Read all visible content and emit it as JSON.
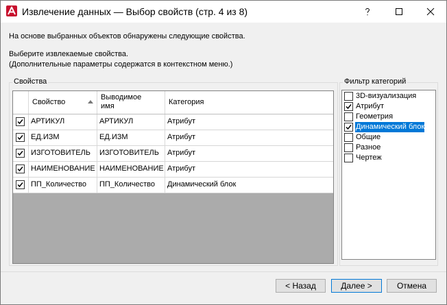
{
  "window": {
    "title": "Извлечение данных — Выбор свойств (стр. 4 из 8)"
  },
  "intro": {
    "line1": "На основе выбранных объектов обнаружены следующие свойства.",
    "line2": "Выберите извлекаемые свойства.",
    "line3": "(Дополнительные параметры содержатся в контекстном меню.)"
  },
  "properties": {
    "legend": "Свойства",
    "columns": {
      "property": "Свойство",
      "display_name_1": "Выводимое",
      "display_name_2": "имя",
      "category": "Категория"
    },
    "sort_column": "Свойство",
    "rows": [
      {
        "checked": true,
        "property": "АРТИКУЛ",
        "display_name": "АРТИКУЛ",
        "category": "Атрибут"
      },
      {
        "checked": true,
        "property": "ЕД.ИЗМ",
        "display_name": "ЕД.ИЗМ",
        "category": "Атрибут"
      },
      {
        "checked": true,
        "property": "ИЗГОТОВИТЕЛЬ",
        "display_name": "ИЗГОТОВИТЕЛЬ",
        "category": "Атрибут"
      },
      {
        "checked": true,
        "property": "НАИМЕНОВАНИЕ",
        "display_name": "НАИМЕНОВАНИЕ",
        "category": "Атрибут"
      },
      {
        "checked": true,
        "property": "ПП_Количество",
        "display_name": "ПП_Количество",
        "category": "Динамический блок"
      }
    ]
  },
  "filter": {
    "legend": "Фильтр категорий",
    "items": [
      {
        "label": "3D-визуализация",
        "checked": false,
        "selected": false
      },
      {
        "label": "Атрибут",
        "checked": true,
        "selected": false
      },
      {
        "label": "Геометрия",
        "checked": false,
        "selected": false
      },
      {
        "label": "Динамический блок",
        "checked": true,
        "selected": true
      },
      {
        "label": "Общие",
        "checked": false,
        "selected": false
      },
      {
        "label": "Разное",
        "checked": false,
        "selected": false
      },
      {
        "label": "Чертеж",
        "checked": false,
        "selected": false
      }
    ]
  },
  "buttons": {
    "back": "< Назад",
    "next": "Далее >",
    "cancel": "Отмена"
  },
  "colors": {
    "app_icon": "#c8102e",
    "selection": "#0078d7",
    "grid_empty": "#ababab"
  },
  "icons": {
    "app": "autocad-a-icon",
    "help": "help-icon",
    "maximize": "maximize-icon",
    "close": "close-icon",
    "checkmark": "checkmark-icon"
  }
}
